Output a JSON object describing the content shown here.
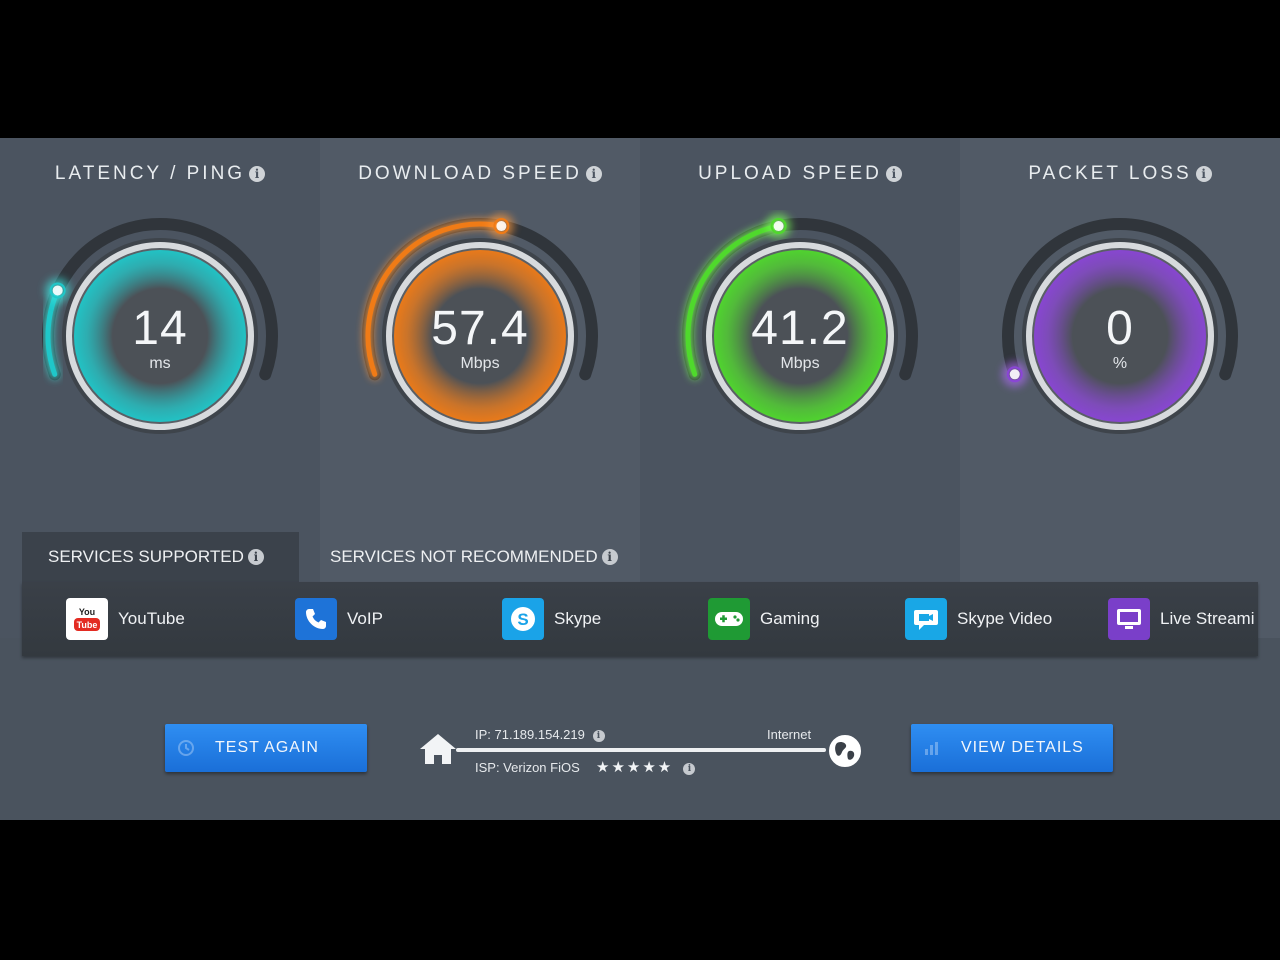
{
  "gauges": [
    {
      "title": "LATENCY / PING",
      "value": "14",
      "unit": "ms",
      "level": 0.2,
      "color": "#1fc7c9",
      "glow": "#3fe6e0"
    },
    {
      "title": "DOWNLOAD SPEED",
      "value": "57.4",
      "unit": "Mbps",
      "level": 0.55,
      "color": "#f07b16",
      "glow": "#ff9a3c"
    },
    {
      "title": "UPLOAD SPEED",
      "value": "41.2",
      "unit": "Mbps",
      "level": 0.45,
      "color": "#4fd92c",
      "glow": "#7cff5a"
    },
    {
      "title": "PACKET LOSS",
      "value": "0",
      "unit": "%",
      "level": 0.0,
      "color": "#8a45d6",
      "glow": "#b46cff"
    }
  ],
  "tabs": {
    "supported": "SERVICES SUPPORTED",
    "not_recommended": "SERVICES NOT RECOMMENDED"
  },
  "services": [
    {
      "label": "YouTube",
      "icon": "youtube-icon",
      "color": "#ffffff"
    },
    {
      "label": "VoIP",
      "icon": "phone-icon",
      "color": "#1e73d8"
    },
    {
      "label": "Skype",
      "icon": "skype-icon",
      "color": "#1aa3e8"
    },
    {
      "label": "Gaming",
      "icon": "gamepad-icon",
      "color": "#1f9a34"
    },
    {
      "label": "Skype Video",
      "icon": "video-icon",
      "color": "#19a7e6"
    },
    {
      "label": "Live Streami",
      "icon": "tv-icon",
      "color": "#7a3fc9"
    }
  ],
  "buttons": {
    "test_again": "TEST AGAIN",
    "view_details": "VIEW DETAILS"
  },
  "connection": {
    "ip": "IP: 71.189.154.219",
    "internet": "Internet",
    "isp": "ISP: Verizon FiOS",
    "stars": "★★★★★",
    "rating": 5
  },
  "info_glyph": "i"
}
